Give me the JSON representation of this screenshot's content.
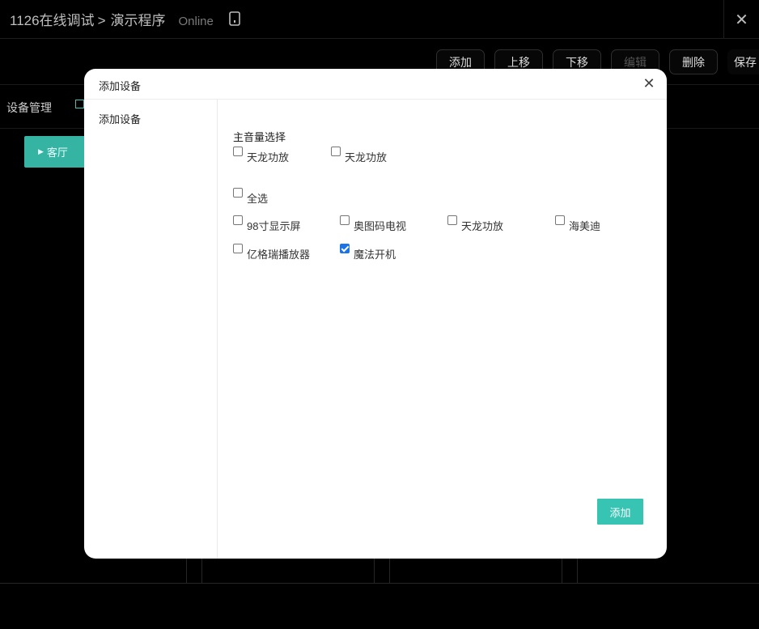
{
  "header": {
    "breadcrumb_root": "1126在线调试",
    "breadcrumb_sep": ">",
    "breadcrumb_current": "演示程序",
    "status": "Online",
    "close_symbol": "✕"
  },
  "toolbar": {
    "add": "添加",
    "move_up": "上移",
    "move_down": "下移",
    "edit": "编辑",
    "delete": "删除",
    "save": "保存"
  },
  "subheader": {
    "title": "设备管理"
  },
  "rooms": [
    {
      "label": "客厅",
      "arrow": "▶"
    }
  ],
  "modal": {
    "title": "添加设备",
    "close_symbol": "✕",
    "side_items": [
      "添加设备"
    ],
    "master_volume_label": "主音量选择",
    "master_volume_options": [
      {
        "label": "天龙功放",
        "checked": false
      },
      {
        "label": "天龙功放",
        "checked": false
      }
    ],
    "select_all_label": "全选",
    "devices": [
      {
        "label": "98寸显示屏",
        "checked": false
      },
      {
        "label": "奥图码电视",
        "checked": false
      },
      {
        "label": "天龙功放",
        "checked": false
      },
      {
        "label": "海美迪",
        "checked": false
      },
      {
        "label": "亿格瑞播放器",
        "checked": false
      },
      {
        "label": "魔法开机",
        "checked": true
      }
    ],
    "submit_label": "添加"
  },
  "colors": {
    "accent": "#37c4b3",
    "room_button": "#35b3a3",
    "checkbox_checked": "#1a73e8"
  }
}
